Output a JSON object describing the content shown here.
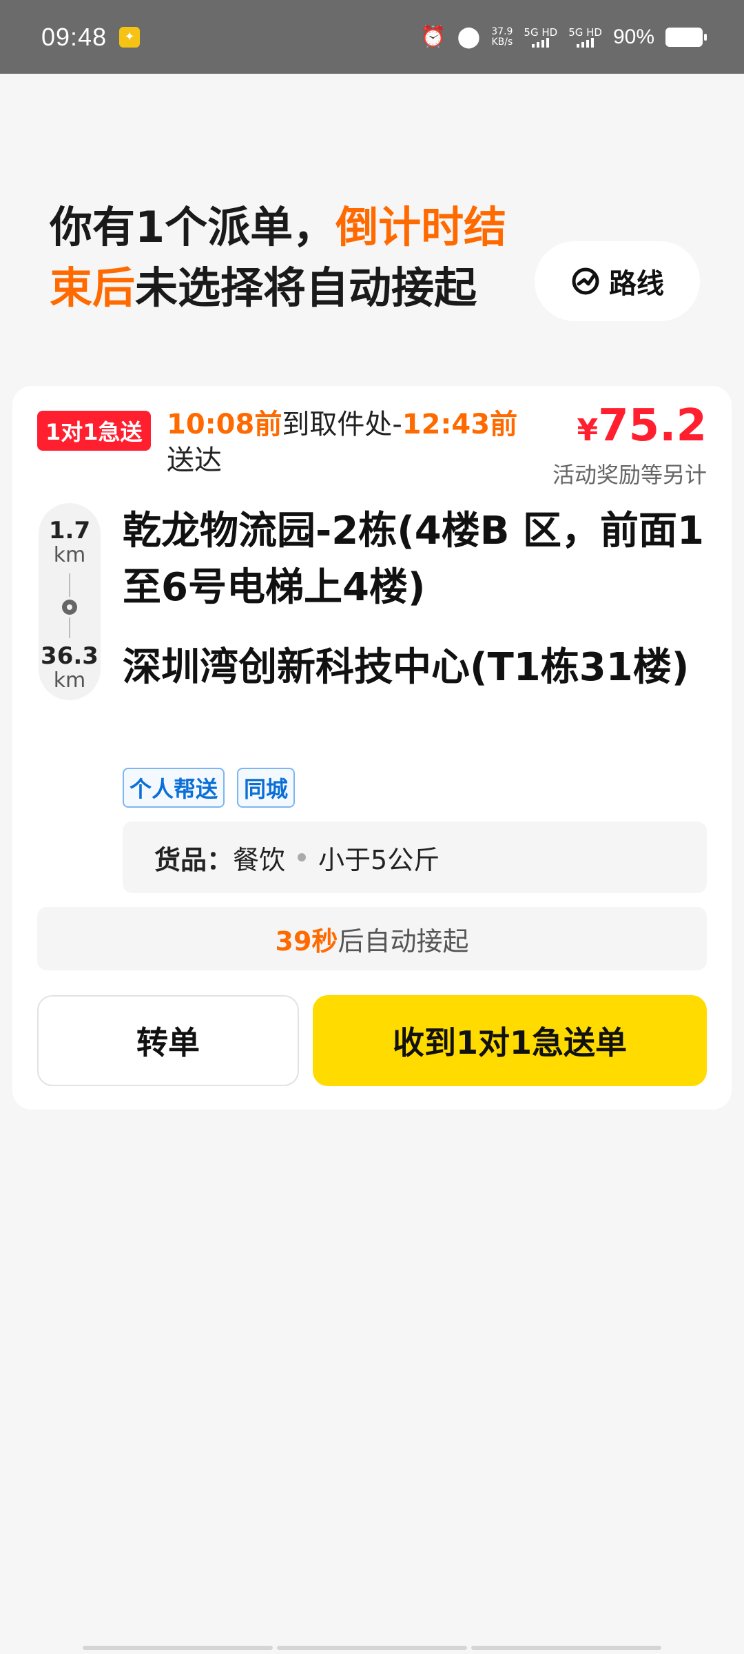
{
  "status_bar": {
    "time": "09:48",
    "speed_value": "37.9",
    "speed_unit": "KB/s",
    "network1": "5G HD",
    "network2": "5G HD",
    "battery": "90%"
  },
  "header": {
    "message_part1": "你有1个派单，",
    "message_highlight": "倒计时结束后",
    "message_part2": "未选择将自动接起",
    "route_button": "路线"
  },
  "order": {
    "badge": "1对1急送",
    "pickup_time": "10:08前",
    "pickup_text": "到取件处-",
    "deliver_time": "12:43前",
    "deliver_text": "送达",
    "price_symbol": "¥",
    "price": "75.2",
    "price_note": "活动奖励等另计",
    "distance_pickup": "1.7",
    "distance_pickup_unit": "km",
    "distance_deliver": "36.3",
    "distance_deliver_unit": "km",
    "pickup_address": "乾龙物流园-2栋(4楼B 区，前面1至6号电梯上4楼)",
    "deliver_address": "深圳湾创新科技中心(T1栋31楼)",
    "tags": [
      "个人帮送",
      "同城"
    ],
    "goods_label": "货品：",
    "goods_type": "餐饮",
    "goods_weight": "小于5公斤",
    "countdown_value": "39秒",
    "countdown_text": "后自动接起",
    "transfer_button": "转单",
    "accept_button": "收到1对1急送单"
  },
  "colors": {
    "accent_orange": "#ff6a00",
    "price_red": "#ff1f2f",
    "accept_yellow": "#ffdb00",
    "tag_blue": "#0a6fd6"
  }
}
